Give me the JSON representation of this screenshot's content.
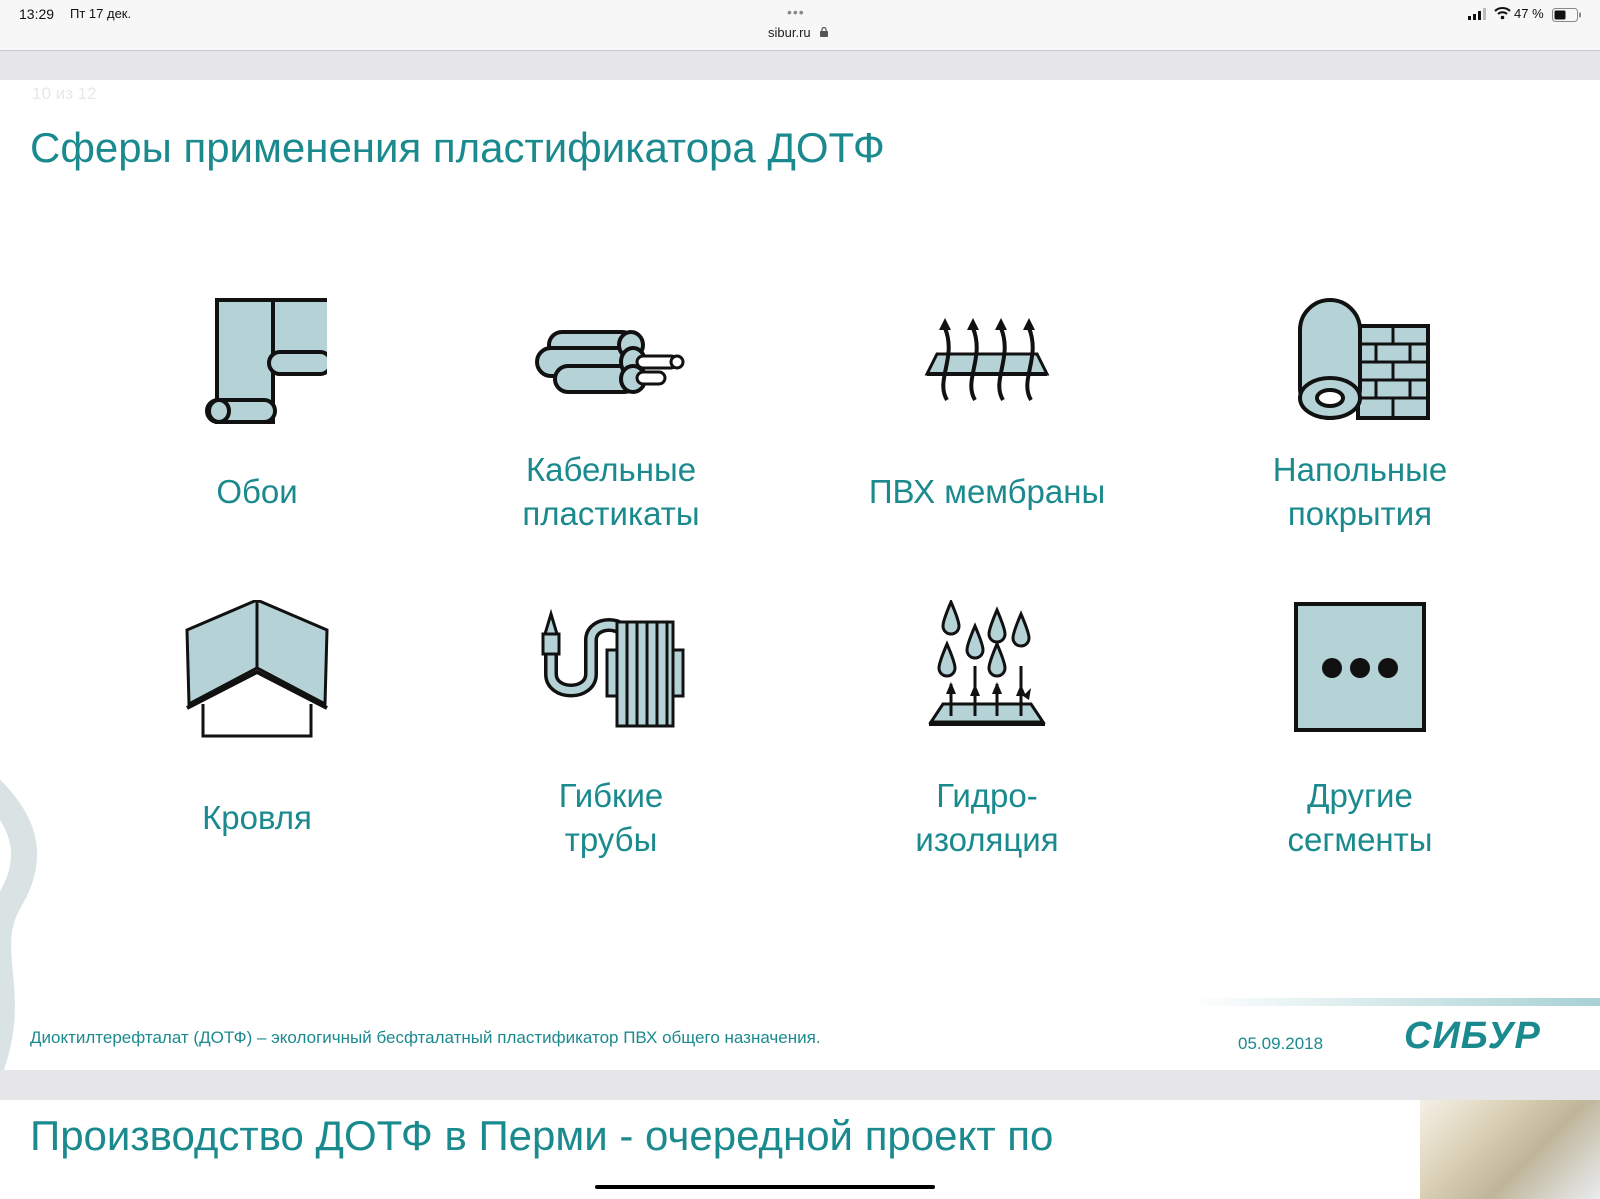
{
  "status_bar": {
    "time": "13:29",
    "date": "Пт 17 дек.",
    "dots": "•••",
    "url": "sibur.ru",
    "battery": "47 %"
  },
  "slide": {
    "counter": "10 из 12",
    "title": "Сферы применения пластификатора ДОТФ",
    "tiles": [
      {
        "icon": "wallpaper-roll-icon",
        "label1": "Обои",
        "label2": ""
      },
      {
        "icon": "cable-icon",
        "label1": "Кабельные",
        "label2": "пластикаты"
      },
      {
        "icon": "membrane-icon",
        "label1": "ПВХ мембраны",
        "label2": ""
      },
      {
        "icon": "floor-roll-icon",
        "label1": "Напольные",
        "label2": "покрытия"
      },
      {
        "icon": "roof-icon",
        "label1": "Кровля",
        "label2": ""
      },
      {
        "icon": "hose-icon",
        "label1": "Гибкие",
        "label2": "трубы"
      },
      {
        "icon": "waterproofing-icon",
        "label1": "Гидро-",
        "label2": "изоляция"
      },
      {
        "icon": "more-icon",
        "label1": "Другие",
        "label2": "сегменты"
      }
    ],
    "footer_text": "Диоктилтерефталат (ДОТФ) – экологичный бесфталатный пластификатор ПВХ общего назначения.",
    "footer_date": "05.09.2018",
    "logo": "СИБУР"
  },
  "next_slide": {
    "title": "Производство ДОТФ в Перми - очередной проект по"
  },
  "colors": {
    "accent": "#1b8a8e",
    "icon_fill": "#b5d3d6"
  }
}
